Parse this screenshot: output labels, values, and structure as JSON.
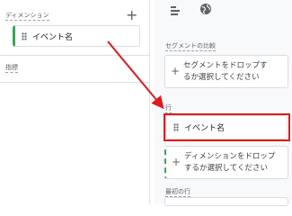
{
  "left": {
    "dimensions_label": "ディメンション",
    "dimension_chip_label": "イベント名",
    "metrics_label": "指標"
  },
  "right": {
    "segment_compare_label": "セグメントの比較",
    "segment_drop_text_1": "セグメントをドロップす",
    "segment_drop_text_2": "るか選択してください",
    "rows_label": "行",
    "row_chip_label": "イベント名",
    "dimension_drop_text_1": "ディメンションをドロップ",
    "dimension_drop_text_2": "するか選択してください",
    "first_row_label": "最初の行"
  },
  "icons": {
    "toolbar_1": "bar-list-icon",
    "toolbar_2": "globe-icon",
    "add": "plus-icon",
    "drag": "drag-handle-icon"
  },
  "colors": {
    "accent_green": "#34a853",
    "highlight_red": "#e01b1b"
  }
}
